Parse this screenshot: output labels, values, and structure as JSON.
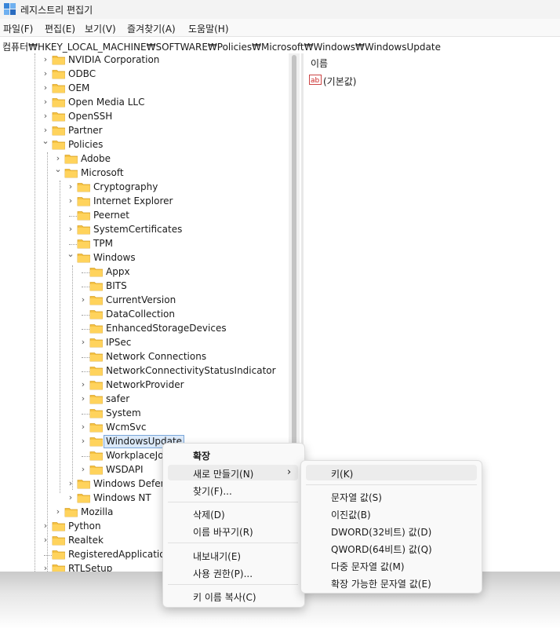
{
  "window": {
    "title": "레지스트리 편집기"
  },
  "menubar": {
    "items": [
      "파일(F)",
      "편집(E)",
      "보기(V)",
      "즐겨찾기(A)",
      "도움말(H)"
    ]
  },
  "addressbar": {
    "path": "컴퓨터₩HKEY_LOCAL_MACHINE₩SOFTWARE₩Policies₩Microsoft₩Windows₩WindowsUpdate"
  },
  "tree": {
    "nodes": [
      {
        "label": "NVIDIA Corporation",
        "expanded": false,
        "has_children": true
      },
      {
        "label": "ODBC",
        "expanded": false,
        "has_children": true
      },
      {
        "label": "OEM",
        "expanded": false,
        "has_children": true
      },
      {
        "label": "Open Media LLC",
        "expanded": false,
        "has_children": true
      },
      {
        "label": "OpenSSH",
        "expanded": false,
        "has_children": true
      },
      {
        "label": "Partner",
        "expanded": false,
        "has_children": true
      },
      {
        "label": "Policies",
        "expanded": true,
        "has_children": true
      },
      {
        "label": "Adobe",
        "expanded": false,
        "has_children": true
      },
      {
        "label": "Microsoft",
        "expanded": true,
        "has_children": true
      },
      {
        "label": "Cryptography",
        "expanded": false,
        "has_children": true
      },
      {
        "label": "Internet Explorer",
        "expanded": false,
        "has_children": true
      },
      {
        "label": "Peernet",
        "expanded": false,
        "has_children": false
      },
      {
        "label": "SystemCertificates",
        "expanded": false,
        "has_children": true
      },
      {
        "label": "TPM",
        "expanded": false,
        "has_children": false
      },
      {
        "label": "Windows",
        "expanded": true,
        "has_children": true
      },
      {
        "label": "Appx",
        "expanded": false,
        "has_children": false
      },
      {
        "label": "BITS",
        "expanded": false,
        "has_children": false
      },
      {
        "label": "CurrentVersion",
        "expanded": false,
        "has_children": true
      },
      {
        "label": "DataCollection",
        "expanded": false,
        "has_children": false
      },
      {
        "label": "EnhancedStorageDevices",
        "expanded": false,
        "has_children": false
      },
      {
        "label": "IPSec",
        "expanded": false,
        "has_children": true
      },
      {
        "label": "Network Connections",
        "expanded": false,
        "has_children": false
      },
      {
        "label": "NetworkConnectivityStatusIndicator",
        "expanded": false,
        "has_children": false
      },
      {
        "label": "NetworkProvider",
        "expanded": false,
        "has_children": true
      },
      {
        "label": "safer",
        "expanded": false,
        "has_children": true
      },
      {
        "label": "System",
        "expanded": false,
        "has_children": false
      },
      {
        "label": "WcmSvc",
        "expanded": false,
        "has_children": true
      },
      {
        "label": "WindowsUpdate",
        "expanded": false,
        "has_children": true,
        "selected": true
      },
      {
        "label": "WorkplaceJoin",
        "expanded": false,
        "has_children": false
      },
      {
        "label": "WSDAPI",
        "expanded": false,
        "has_children": true
      },
      {
        "label": "Windows Defender",
        "expanded": false,
        "has_children": true
      },
      {
        "label": "Windows NT",
        "expanded": false,
        "has_children": true
      },
      {
        "label": "Mozilla",
        "expanded": false,
        "has_children": true
      },
      {
        "label": "Python",
        "expanded": false,
        "has_children": true
      },
      {
        "label": "Realtek",
        "expanded": false,
        "has_children": true
      },
      {
        "label": "RegisteredApplications",
        "expanded": false,
        "has_children": false
      },
      {
        "label": "RTLSetup",
        "expanded": false,
        "has_children": true
      }
    ]
  },
  "values": {
    "column_name": "이름",
    "rows": [
      {
        "name": "(기본값)",
        "icon": "string-value-icon"
      }
    ]
  },
  "context_menu": {
    "expand": "확장",
    "new": "새로 만들기(N)",
    "find": "찾기(F)...",
    "delete": "삭제(D)",
    "rename": "이름 바꾸기(R)",
    "export": "내보내기(E)",
    "permissions": "사용 권한(P)...",
    "copy_key_name": "키 이름 복사(C)"
  },
  "submenu": {
    "key": "키(K)",
    "string_value": "문자열 값(S)",
    "binary_value": "이진값(B)",
    "dword_value": "DWORD(32비트) 값(D)",
    "qword_value": "QWORD(64비트) 값(Q)",
    "multi_string_value": "다중 문자열 값(M)",
    "expandable_string_value": "확장 가능한 문자열 값(E)"
  },
  "colors": {
    "folder": "#f5c242",
    "selection": "#dbe9f9",
    "menu_bg": "#f9f9f9",
    "hover": "#ececec"
  }
}
